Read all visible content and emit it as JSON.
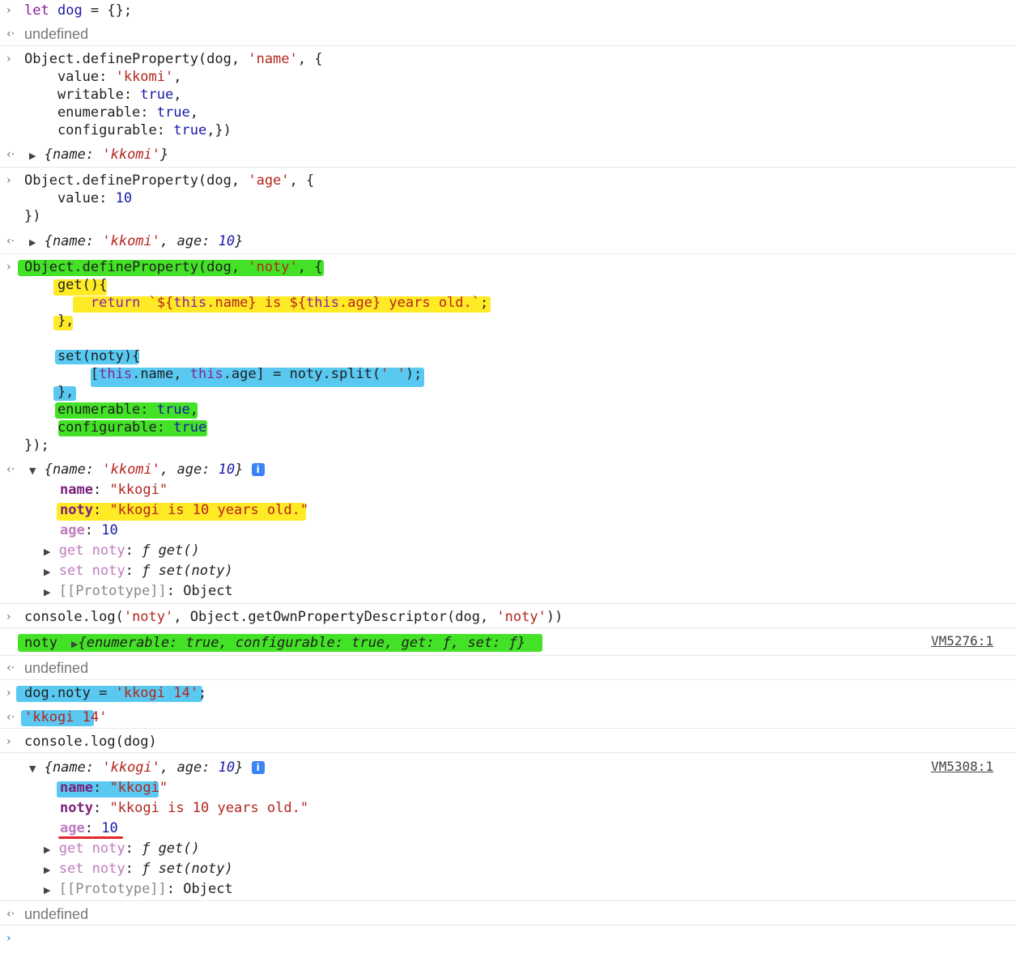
{
  "gutter": {
    "input": "›",
    "output": "‹·",
    "prompt": "›"
  },
  "entries": {
    "e1": {
      "code": [
        "let dog = {};"
      ],
      "result": "undefined"
    },
    "e2": {
      "code": [
        "Object.defineProperty(dog, 'name', {",
        "    value: 'kkomi',",
        "    writable: true,",
        "    enumerable: true,",
        "    configurable: true,})"
      ],
      "result": "{name: 'kkomi'}"
    },
    "e3": {
      "code": [
        "Object.defineProperty(dog, 'age', {",
        "    value: 10",
        "})"
      ],
      "result": "{name: 'kkomi', age: 10}"
    },
    "e4": {
      "code": [
        "Object.defineProperty(dog, 'noty', {",
        "    get(){",
        "        return `${this.name} is ${this.age} years old.`;",
        "    },",
        "",
        "    set(noty){",
        "        [this.name, this.age] = noty.split(' ');",
        "    },",
        "    enumerable: true,",
        "    configurable: true",
        "});"
      ],
      "result": "{name: 'kkomi', age: 10}",
      "props": [
        {
          "key": "name",
          "value": "\"kkogi\""
        },
        {
          "key": "noty",
          "value": "\"kkogi is 10 years old.\""
        },
        {
          "key": "age",
          "value": "10"
        }
      ],
      "accessors": [
        "get noty: ƒ get()",
        "set noty: ƒ set(noty)",
        "[[Prototype]]: Object"
      ]
    },
    "e5": {
      "code": [
        "console.log('noty', Object.getOwnPropertyDescriptor(dog, 'noty'))"
      ],
      "log_label": "noty",
      "log_value": "{enumerable: true, configurable: true, get: ƒ, set: ƒ}",
      "source": "VM5276:1",
      "result": "undefined"
    },
    "e6": {
      "code": [
        "dog.noty = 'kkogi 14';"
      ],
      "result": "'kkogi 14'"
    },
    "e7": {
      "code": [
        "console.log(dog)"
      ],
      "summary": "{name: 'kkogi', age: 10}",
      "source": "VM5308:1",
      "props": [
        {
          "key": "name",
          "value": "\"kkogi\""
        },
        {
          "key": "noty",
          "value": "\"kkogi is 10 years old.\""
        },
        {
          "key": "age",
          "value": "10"
        }
      ],
      "accessors": [
        "get noty: ƒ get()",
        "set noty: ƒ set(noty)",
        "[[Prototype]]: Object"
      ],
      "result": "undefined"
    }
  },
  "highlight_colors": {
    "green": "#22dd00",
    "yellow": "#ffe600",
    "blue": "#3cc0f0",
    "red": "#e00000"
  },
  "info_icon_label": "i"
}
